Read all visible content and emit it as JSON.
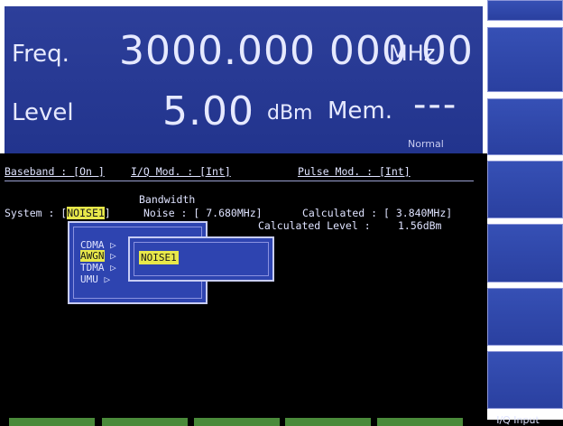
{
  "display": {
    "freq_label": "Freq.",
    "freq_value": "3000.000 000 00",
    "freq_unit": "MHz",
    "level_label": "Level",
    "level_value": "5.00",
    "level_unit": "dBm",
    "mem_label": "Mem.",
    "mem_value": "---",
    "status": "Normal"
  },
  "status_line": {
    "baseband": "Baseband : [On ]",
    "iq_mod": "I/Q Mod. : [Int]",
    "pulse_mod": "Pulse Mod. : [Int]"
  },
  "system": {
    "system_prefix": "System : [",
    "system_value": "NOISE1",
    "system_suffix": "]",
    "bandwidth_label": "Bandwidth",
    "noise_text": "Noise : [ 7.680MHz]",
    "calculated_text": "Calculated : [ 3.840MHz]",
    "calculated_level_label": "Calculated Level :",
    "calculated_level_value": "1.56dBm"
  },
  "menu": {
    "items": [
      "CDMA",
      "AWGN",
      "TDMA",
      "UMU"
    ],
    "selected": "AWGN",
    "submenu_item": "NOISE1"
  },
  "bottom": {
    "tab_label": "I/Q Input"
  },
  "colors": {
    "panel_blue": "#22348d",
    "highlight_yellow": "#e8e84a",
    "softkey_green": "#4a8a3a"
  }
}
